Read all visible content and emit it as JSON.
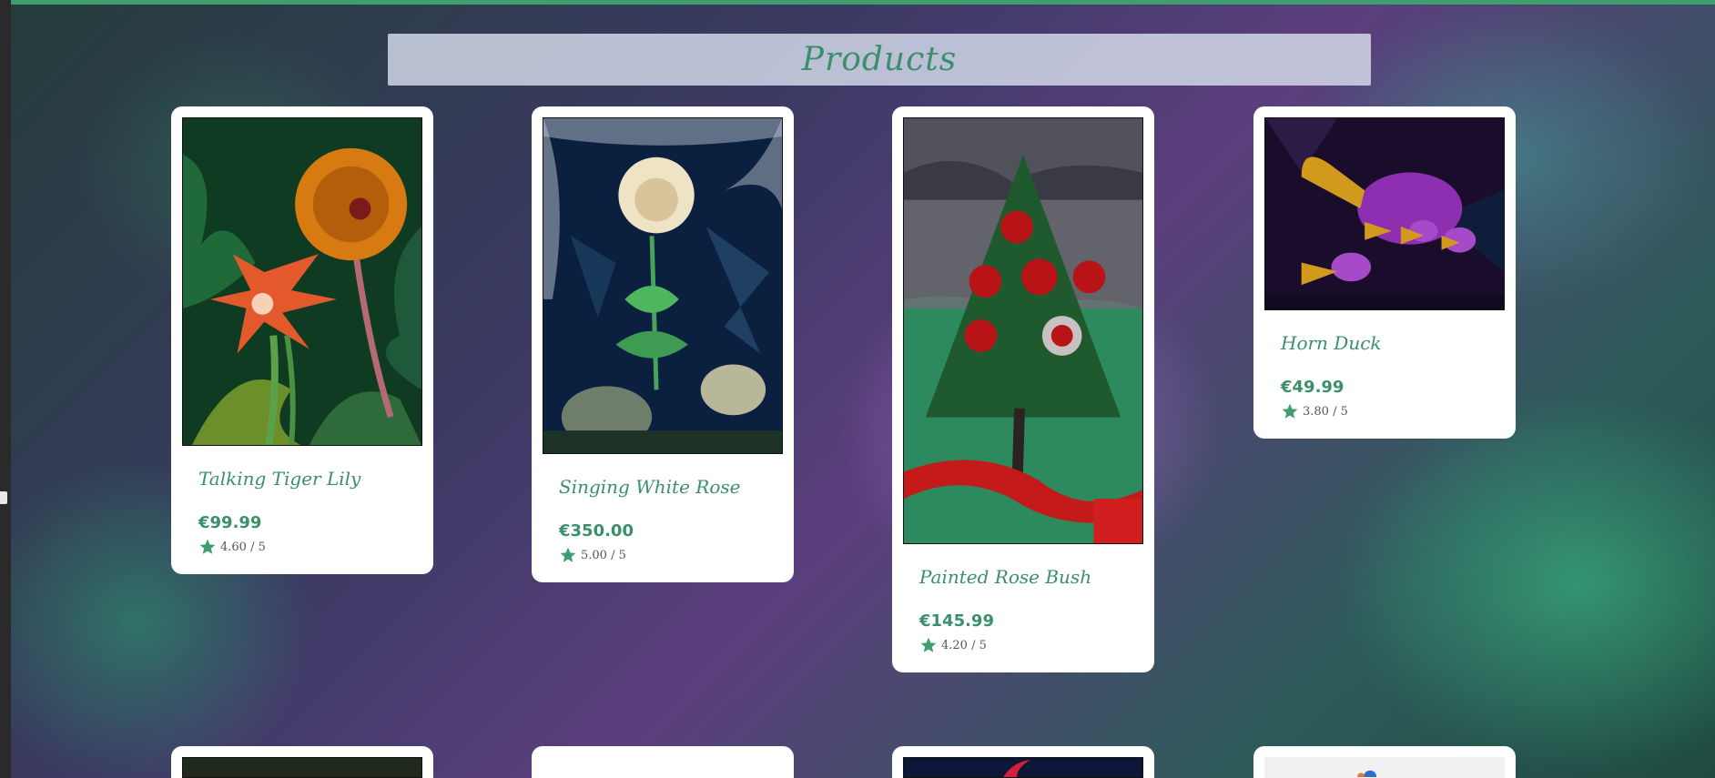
{
  "page": {
    "title": "Products"
  },
  "colors": {
    "accent": "#3f9e6d",
    "text_green": "#3b8f6a"
  },
  "products": [
    {
      "name": "Talking Tiger Lily",
      "price": "€99.99",
      "rating": "4.60 / 5"
    },
    {
      "name": "Singing White Rose",
      "price": "€350.00",
      "rating": "5.00 / 5"
    },
    {
      "name": "Painted Rose Bush",
      "price": "€145.99",
      "rating": "4.20 / 5"
    },
    {
      "name": "Horn Duck",
      "price": "€49.99",
      "rating": "3.80 / 5"
    }
  ],
  "icons": {
    "rating": "star-icon"
  }
}
